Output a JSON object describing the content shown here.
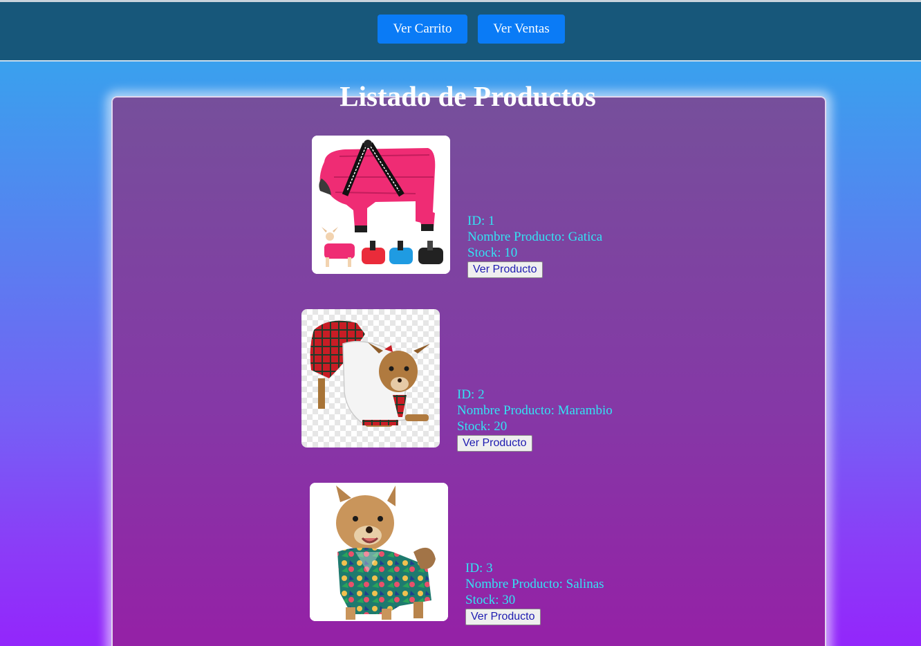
{
  "header": {
    "cart_label": "Ver Carrito",
    "sales_label": "Ver Ventas"
  },
  "main": {
    "title": "Listado de Productos"
  },
  "products": [
    {
      "id_text": "ID: 1",
      "name_text": "Nombre Producto: Gatica",
      "stock_text": "Stock: 10",
      "button_label": "Ver Producto",
      "image": "pink-dog-jacket-photo"
    },
    {
      "id_text": "ID: 2",
      "name_text": "Nombre Producto: Marambio",
      "stock_text": "Stock: 20",
      "button_label": "Ver Producto",
      "image": "plaid-skirt-dog-photo"
    },
    {
      "id_text": "ID: 3",
      "name_text": "Nombre Producto: Salinas",
      "stock_text": "Stock: 30",
      "button_label": "Ver Producto",
      "image": "hawaiian-shirt-dog-photo"
    }
  ],
  "colors": {
    "header_bg": "#17577a",
    "nav_button_bg": "#0a7bf6",
    "info_text": "#33e4f4",
    "panel_bg": "#8538a6"
  }
}
